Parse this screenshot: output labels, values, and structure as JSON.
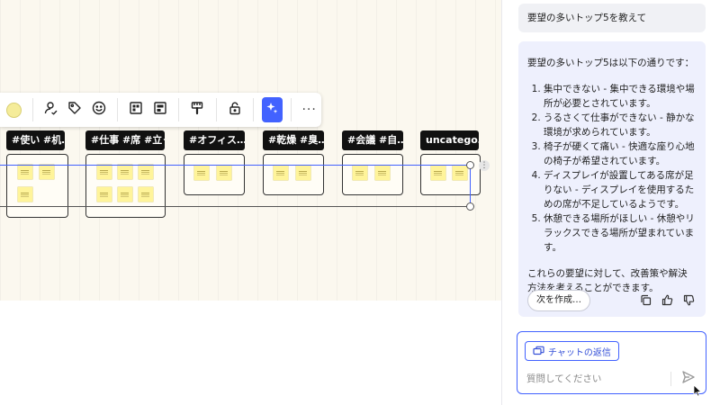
{
  "canvas": {
    "clusters": [
      {
        "label": "#使い #机…"
      },
      {
        "label": "#仕事 #席 #立っ"
      },
      {
        "label": "#オフィス…"
      },
      {
        "label": "#乾燥 #臭…"
      },
      {
        "label": "#会議 #自…"
      },
      {
        "label": "uncatego…"
      }
    ],
    "toolbar": {
      "icons": [
        "color-swatch",
        "assign-icon",
        "tag-icon",
        "emoji-icon",
        "grid-layout-icon",
        "align-icon",
        "format-paint-icon",
        "lock-icon",
        "ai-sparkle-icon",
        "more-icon"
      ],
      "more_label": "···",
      "swatch_color": "#f5ec9a",
      "ai_color": "#4262ff"
    }
  },
  "chat": {
    "user_message": "要望の多いトップ5を教えて",
    "assistant": {
      "intro": "要望の多いトップ5は以下の通りです：",
      "items": [
        "集中できない - 集中できる環境や場所が必要とされています。",
        "うるさくて仕事ができない - 静かな環境が求められています。",
        "椅子が硬くて痛い - 快適な座り心地の椅子が希望されています。",
        "ディスプレイが設置してある席が足りない - ディスプレイを使用するための席が不足しているようです。",
        "休憩できる場所がほしい - 休憩やリラックスできる場所が望まれています。"
      ],
      "summary": "これらの要望に対して、改善策や解決方法を考えることができます。",
      "next_button": "次を作成…"
    },
    "reply_chip": "チャットの返信",
    "input": {
      "placeholder": "質問してください",
      "value": ""
    },
    "accent_color": "#4262ff"
  }
}
